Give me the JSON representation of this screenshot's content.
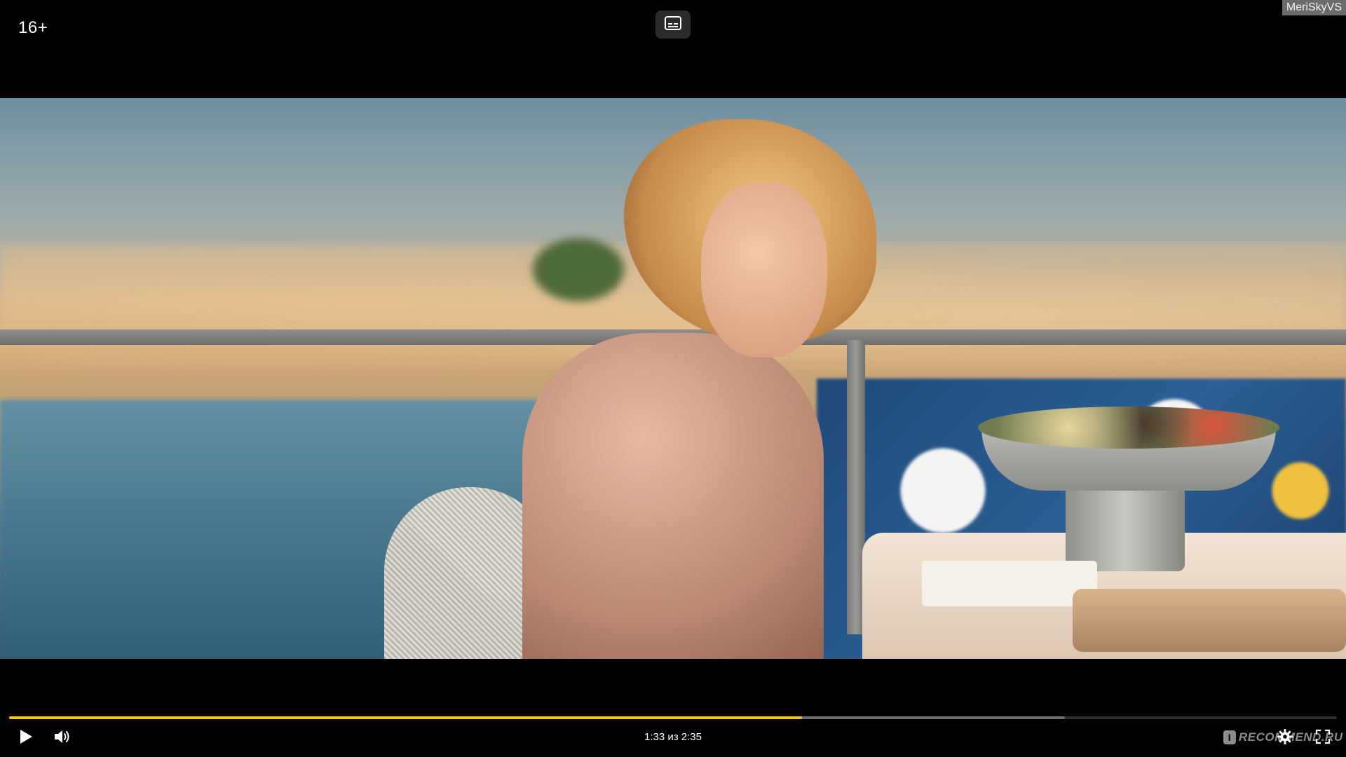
{
  "player": {
    "age_rating": "16+",
    "user_watermark": "MeriSkyVS",
    "site_watermark": "RECOMMEND.RU",
    "site_watermark_mark": "I",
    "time_display": "1:33 из 2:35",
    "progress": {
      "played_fraction": 0.597,
      "buffered_fraction": 0.795
    },
    "icons": {
      "subtitles": "subtitles-icon",
      "play": "play-icon",
      "volume": "volume-icon",
      "settings": "gear-icon",
      "fullscreen": "fullscreen-icon"
    },
    "colors": {
      "accent": "#f5c518",
      "background": "#000000"
    }
  }
}
